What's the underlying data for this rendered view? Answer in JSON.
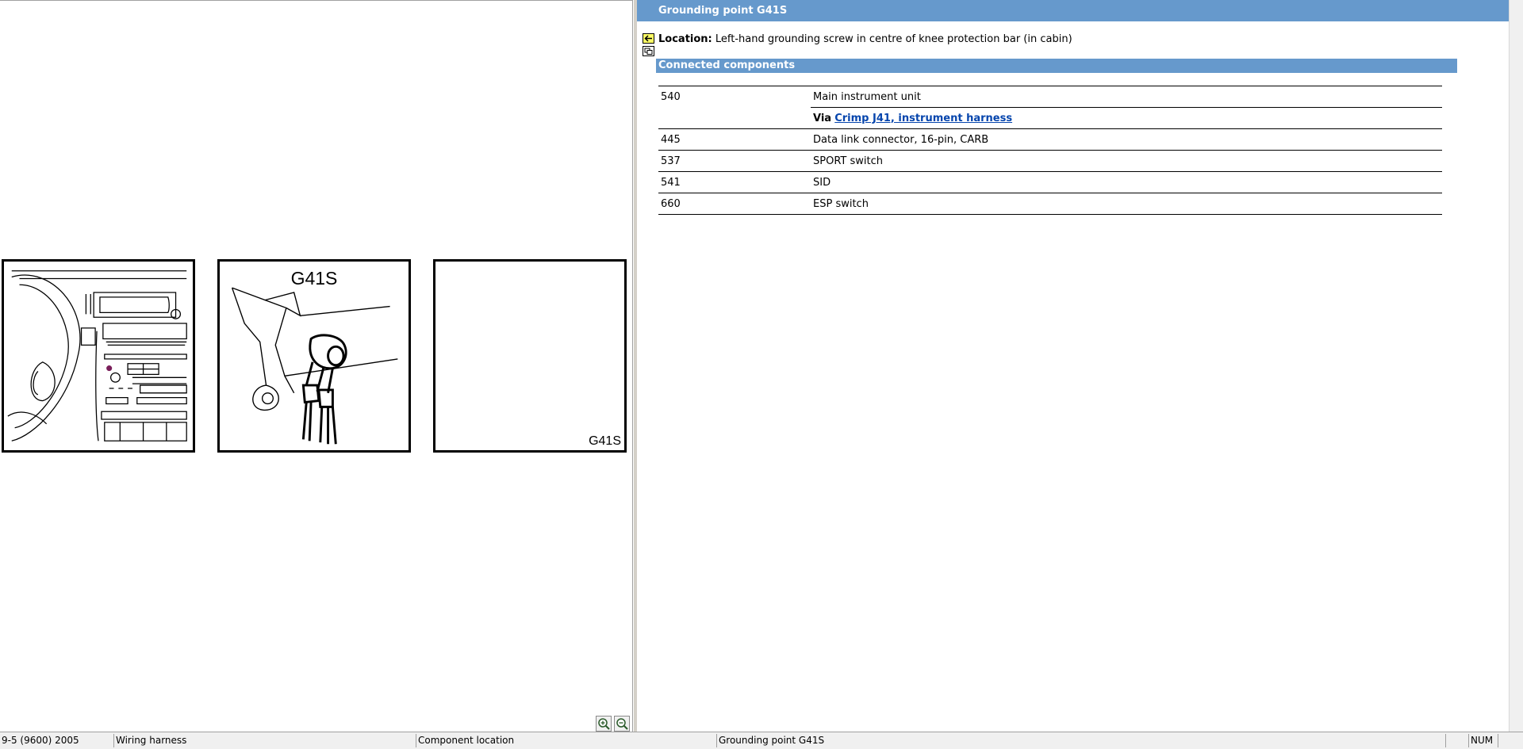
{
  "header": {
    "title": "Grounding point G41S"
  },
  "location": {
    "label": "Location:",
    "text": "Left-hand grounding screw in centre of knee protection bar (in cabin)"
  },
  "section": {
    "title": "Connected components"
  },
  "components": [
    {
      "number": "540",
      "description": "Main instrument unit"
    },
    {
      "via_prefix": "Via",
      "via_link": "Crimp J41, instrument harness"
    },
    {
      "number": "445",
      "description": "Data link connector, 16-pin, CARB"
    },
    {
      "number": "537",
      "description": "SPORT switch"
    },
    {
      "number": "541",
      "description": "SID"
    },
    {
      "number": "660",
      "description": "ESP switch"
    }
  ],
  "illustrations": {
    "detail_label": "G41S",
    "location_label": "G41S"
  },
  "icons": {
    "back": "back-arrow-icon",
    "copy": "copy-icon",
    "zoom_in": "zoom-in-icon",
    "zoom_out": "zoom-out-icon"
  },
  "status_bar": {
    "model": "9-5 (9600) 2005",
    "category": "Wiring harness",
    "view": "Component location",
    "item": "Grounding point G41S",
    "blank": "",
    "num": "NUM"
  },
  "colors": {
    "header_bg": "#6699cc",
    "link": "#0645ad"
  }
}
